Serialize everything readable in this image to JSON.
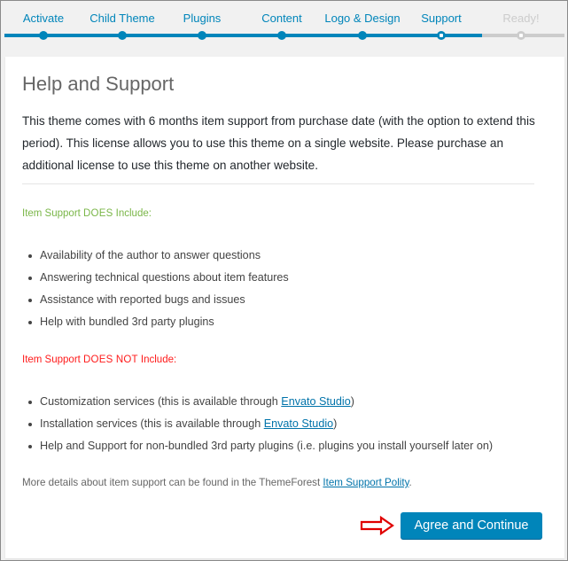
{
  "steps": [
    {
      "label": "Activate",
      "state": "done"
    },
    {
      "label": "Child Theme",
      "state": "done"
    },
    {
      "label": "Plugins",
      "state": "done"
    },
    {
      "label": "Content",
      "state": "done"
    },
    {
      "label": "Logo & Design",
      "state": "done"
    },
    {
      "label": "Support",
      "state": "current"
    },
    {
      "label": "Ready!",
      "state": "todo"
    }
  ],
  "card": {
    "title": "Help and Support",
    "intro": "This theme comes with 6 months item support from purchase date (with the option to extend this period). This license allows you to use this theme on a single website. Please purchase an additional license to use this theme on another website.",
    "does": {
      "prefix": "Item Support ",
      "emphasis": "DOES",
      "suffix": " Include:",
      "items": [
        "Availability of the author to answer questions",
        "Answering technical questions about item features",
        "Assistance with reported bugs and issues",
        "Help with bundled 3rd party plugins"
      ]
    },
    "doesnot": {
      "prefix": "Item Support ",
      "emphasis": "DOES NOT",
      "suffix": " Include:",
      "items": [
        {
          "text": "Customization services (this is available through ",
          "link": "Envato Studio",
          "after": ")"
        },
        {
          "text": "Installation services (this is available through ",
          "link": "Envato Studio",
          "after": ")"
        },
        {
          "text": "Help and Support for non-bundled 3rd party plugins (i.e. plugins you install yourself later on)",
          "link": "",
          "after": ""
        }
      ]
    },
    "more": {
      "text": "More details about item support can be found in the ThemeForest ",
      "link": "Item Support Polity",
      "after": "."
    },
    "button_label": "Agree and Continue"
  },
  "colors": {
    "accent": "#0085ba",
    "inactive": "#cccccc",
    "does_green": "#7ab648",
    "doesnot_red": "#ff1a1a",
    "annotation_arrow": "#e00000"
  }
}
